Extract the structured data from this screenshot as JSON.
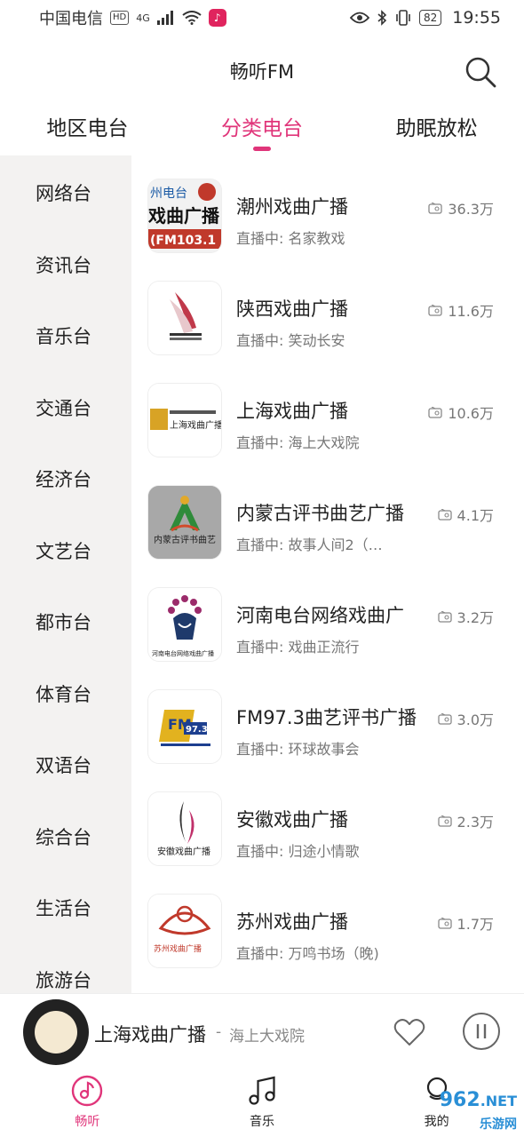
{
  "status_bar": {
    "carrier": "中国电信",
    "hd": "HD",
    "network": "4G",
    "battery": "82",
    "time": "19:55"
  },
  "header": {
    "title": "畅听FM"
  },
  "tabs": [
    {
      "label": "地区电台"
    },
    {
      "label": "分类电台"
    },
    {
      "label": "助眠放松"
    }
  ],
  "sidebar": {
    "items": [
      {
        "label": "网络台"
      },
      {
        "label": "资讯台"
      },
      {
        "label": "音乐台"
      },
      {
        "label": "交通台"
      },
      {
        "label": "经济台"
      },
      {
        "label": "文艺台"
      },
      {
        "label": "都市台"
      },
      {
        "label": "体育台"
      },
      {
        "label": "双语台"
      },
      {
        "label": "综合台"
      },
      {
        "label": "生活台"
      },
      {
        "label": "旅游台"
      }
    ]
  },
  "stations": [
    {
      "name": "潮州戏曲广播",
      "sub": "直播中: 名家教戏",
      "count": "36.3万",
      "logo_text": "戏曲广播",
      "logo_sub": "(FM103.1",
      "logo_top": "州电台"
    },
    {
      "name": "陕西戏曲广播",
      "sub": "直播中: 笑动长安",
      "count": "11.6万"
    },
    {
      "name": "上海戏曲广播",
      "sub": "直播中: 海上大戏院",
      "count": "10.6万",
      "logo_text": "上海戏曲广播"
    },
    {
      "name": "内蒙古评书曲艺广播",
      "sub": "直播中: 故事人间2（…",
      "count": "4.1万",
      "logo_text": "内蒙古评书曲艺"
    },
    {
      "name": "河南电台网络戏曲广",
      "sub": "直播中: 戏曲正流行",
      "count": "3.2万",
      "logo_text": "河南电台网络戏曲广播"
    },
    {
      "name": "FM97.3曲艺评书广播",
      "sub": "直播中: 环球故事会",
      "count": "3.0万",
      "logo_text": "97.3"
    },
    {
      "name": "安徽戏曲广播",
      "sub": "直播中: 归途小情歌",
      "count": "2.3万",
      "logo_text": "安徽戏曲广播"
    },
    {
      "name": "苏州戏曲广播",
      "sub": "直播中: 万鸣书场（晚)",
      "count": "1.7万",
      "logo_text": "苏州戏曲广播"
    }
  ],
  "player": {
    "title": "上海戏曲广播",
    "separator": "-",
    "program": "海上大戏院"
  },
  "bottom_nav": [
    {
      "label": "畅听"
    },
    {
      "label": "音乐"
    },
    {
      "label": "我的"
    }
  ],
  "watermark": {
    "main": "962",
    "suffix": ".NET",
    "sub": "乐游网"
  },
  "colors": {
    "accent": "#e0357a",
    "sidebar_bg": "#f3f2f1"
  }
}
